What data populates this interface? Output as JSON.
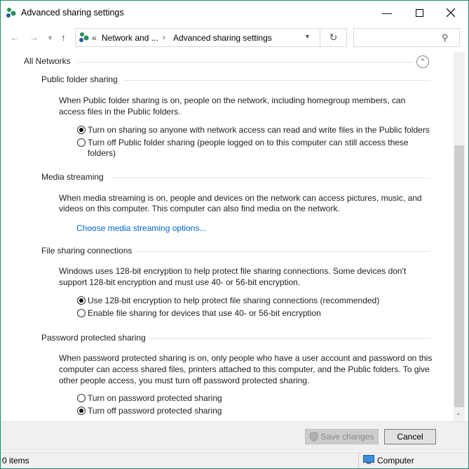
{
  "window": {
    "title": "Advanced sharing settings"
  },
  "address": {
    "overflow": "«",
    "crumbs": [
      "Network and ...",
      "Advanced sharing settings"
    ]
  },
  "search": {
    "placeholder": ""
  },
  "all_networks": {
    "label": "All Networks"
  },
  "public_folder": {
    "title": "Public folder sharing",
    "desc1": "When Public folder sharing is on, people on the network, including homegroup members, can",
    "desc2": "access files in the Public folders.",
    "opt1": "Turn on sharing so anyone with network access can read and write files in the Public folders",
    "opt2a": "Turn off Public folder sharing (people logged on to this computer can still access these",
    "opt2b": "folders)",
    "selected": 1
  },
  "media": {
    "title": "Media streaming",
    "desc1": "When media streaming is on, people and devices on the network can access pictures, music, and",
    "desc2": "videos on this computer. This computer can also find media on the network.",
    "link": "Choose media streaming options..."
  },
  "file_sharing": {
    "title": "File sharing connections",
    "desc1": "Windows uses 128-bit encryption to help protect file sharing connections. Some devices don't",
    "desc2": "support 128-bit encryption and must use 40- or 56-bit encryption.",
    "opt1": "Use 128-bit encryption to help protect file sharing connections (recommended)",
    "opt2": "Enable file sharing for devices that use 40- or 56-bit encryption",
    "selected": 1
  },
  "password": {
    "title": "Password protected sharing",
    "desc1": "When password protected sharing is on, only people who have a user account and password on this",
    "desc2": "computer can access shared files, printers attached to this computer, and the Public folders. To give",
    "desc3": "other people access, you must turn off password protected sharing.",
    "opt1": "Turn on password protected sharing",
    "opt2": "Turn off password protected sharing",
    "selected": 2
  },
  "footer": {
    "save": "Save changes",
    "cancel": "Cancel"
  },
  "status": {
    "items": "0 items",
    "location": "Computer"
  },
  "colors": {
    "accent": "#1e8a6e",
    "link": "#0066cc"
  }
}
